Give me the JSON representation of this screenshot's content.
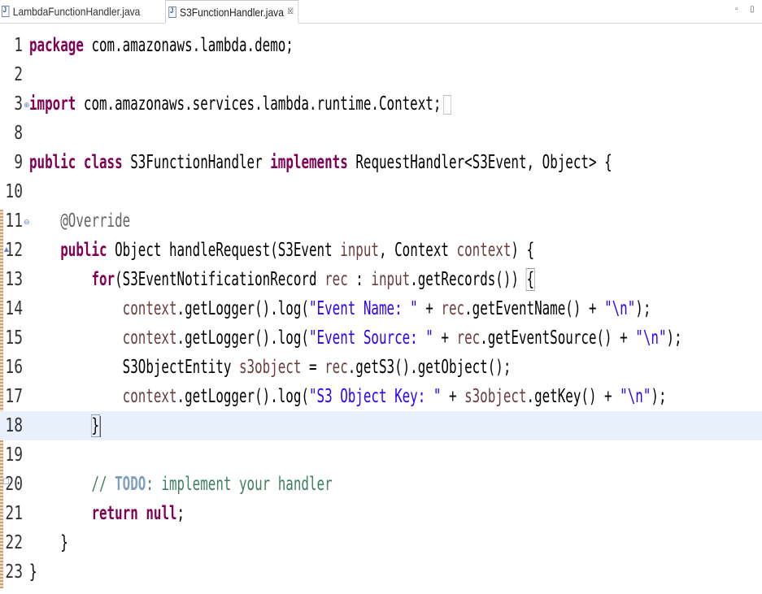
{
  "tabs": [
    {
      "label": "LambdaFunctionHandler.java",
      "active": false
    },
    {
      "label": "S3FunctionHandler.java",
      "active": true,
      "close": "☒"
    }
  ],
  "window_controls": {
    "minimize": "▫",
    "maximize": "▯"
  },
  "editor": {
    "current_line": 18,
    "lines": [
      {
        "num": "1",
        "text": "package com.amazonaws.lambda.demo;"
      },
      {
        "num": "2",
        "text": ""
      },
      {
        "num": "3",
        "text": "import com.amazonaws.services.lambda.runtime.Context;"
      },
      {
        "num": "8",
        "text": ""
      },
      {
        "num": "9",
        "text": "public class S3FunctionHandler implements RequestHandler<S3Event, Object> {"
      },
      {
        "num": "10",
        "text": ""
      },
      {
        "num": "11",
        "text": "    @Override"
      },
      {
        "num": "12",
        "text": "    public Object handleRequest(S3Event input, Context context) {"
      },
      {
        "num": "13",
        "text": "        for(S3EventNotificationRecord rec : input.getRecords()) {"
      },
      {
        "num": "14",
        "text": "            context.getLogger().log(\"Event Name: \" + rec.getEventName() + \"\\n\");"
      },
      {
        "num": "15",
        "text": "            context.getLogger().log(\"Event Source: \" + rec.getEventSource() + \"\\n\");"
      },
      {
        "num": "16",
        "text": "            S3ObjectEntity s3object = rec.getS3().getObject();"
      },
      {
        "num": "17",
        "text": "            context.getLogger().log(\"S3 Object Key: \" + s3object.getKey() + \"\\n\");"
      },
      {
        "num": "18",
        "text": "        }"
      },
      {
        "num": "19",
        "text": ""
      },
      {
        "num": "20",
        "text": "        // TODO: implement your handler"
      },
      {
        "num": "21",
        "text": "        return null;"
      },
      {
        "num": "22",
        "text": "    }"
      },
      {
        "num": "23",
        "text": "}"
      }
    ]
  }
}
